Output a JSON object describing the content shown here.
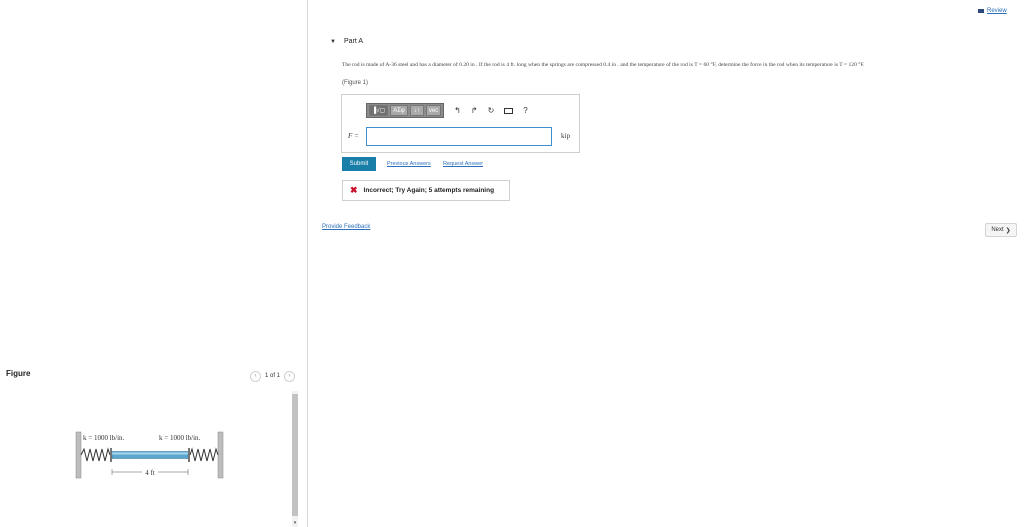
{
  "header": {
    "review_label": "Review",
    "review_icon": "book-icon"
  },
  "part": {
    "title": "Part A",
    "caret": "▼"
  },
  "problem": {
    "text": "The rod is made of A-36 steel and has a diameter of 0.20 in . If the rod is 4 ft. long when the springs are compressed 0.4 in . and the temperature of the rod is T = 60 °F, determine the force in the rod when its temperature is T = 120 °F.",
    "figure_link": "(Figure 1)"
  },
  "toolbar": {
    "items": [
      "▐√▢",
      "ΑΣφ",
      "↓↑",
      "vec"
    ],
    "undo": "↰",
    "redo": "↱",
    "reset": "↻",
    "help": "?"
  },
  "answer": {
    "label": "F =",
    "value": "",
    "placeholder": "",
    "unit": "kip"
  },
  "actions": {
    "submit_label": "Submit",
    "previous_answers_label": "Previous Answers",
    "request_answer_label": "Request Answer"
  },
  "feedback": {
    "icon": "✖",
    "text": "Incorrect; Try Again; 5 attempts remaining"
  },
  "footer": {
    "provide_feedback_label": "Provide Feedback",
    "next_label": "Next",
    "next_icon": "❯"
  },
  "figure": {
    "heading": "Figure",
    "page_indicator": "1 of 1",
    "prev_icon": "‹",
    "next_icon": "›",
    "spring_left_label": "k = 1000 lb/in.",
    "spring_right_label": "k = 1000 lb/in.",
    "length_label": "4 ft"
  },
  "colors": {
    "accent": "#1a7fa8",
    "link": "#2b6fbd",
    "error": "#c8102e",
    "rod": "#5aa8d0"
  }
}
